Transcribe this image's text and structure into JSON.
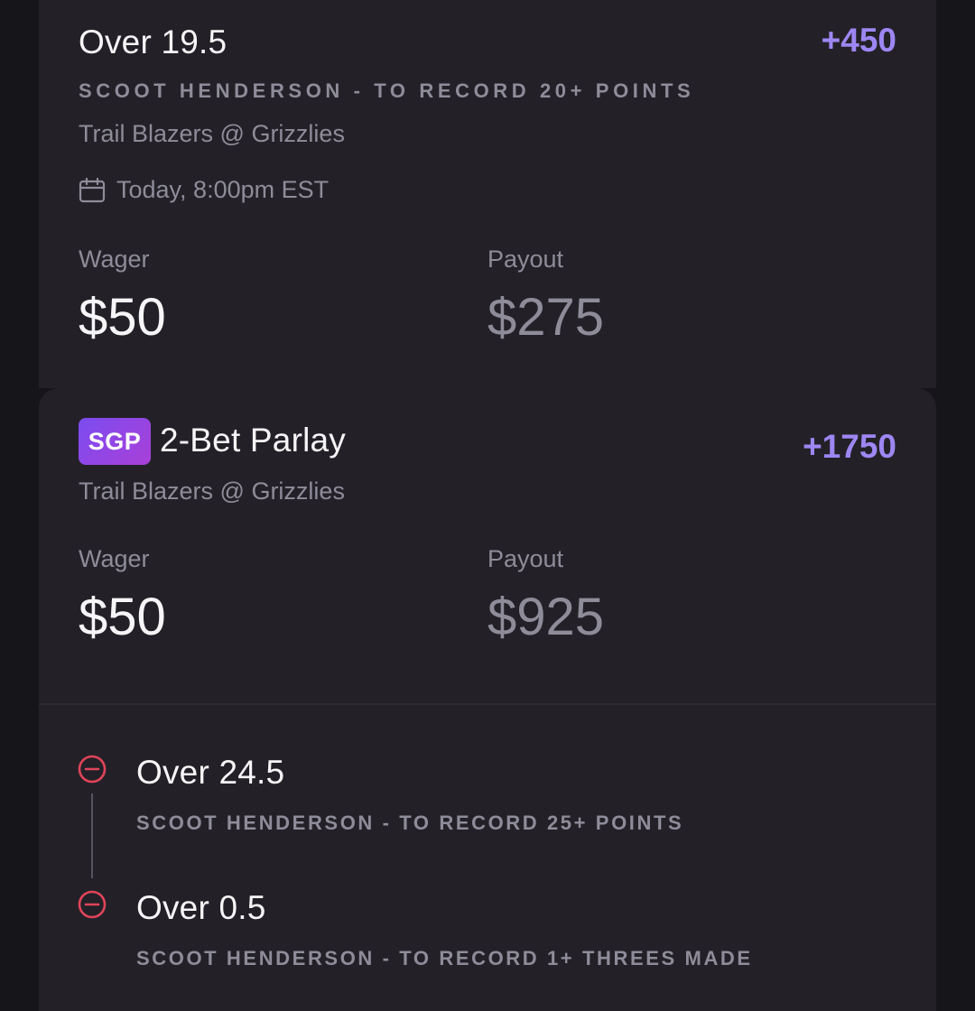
{
  "bet1": {
    "selection": "Over 19.5",
    "odds": "+450",
    "market": "SCOOT HENDERSON - TO RECORD 20+ POINTS",
    "game": "Trail Blazers @ Grizzlies",
    "time": "Today, 8:00pm EST",
    "wager_label": "Wager",
    "wager": "$50",
    "payout_label": "Payout",
    "payout": "$275"
  },
  "parlay": {
    "badge": "SGP",
    "title": "2-Bet Parlay",
    "odds": "+1750",
    "game": "Trail Blazers @ Grizzlies",
    "wager_label": "Wager",
    "wager": "$50",
    "payout_label": "Payout",
    "payout": "$925",
    "legs": [
      {
        "status": "lost",
        "selection": "Over 24.5",
        "market": "SCOOT HENDERSON - TO RECORD 25+ POINTS"
      },
      {
        "status": "lost",
        "selection": "Over 0.5",
        "market": "SCOOT HENDERSON - TO RECORD 1+ THREES MADE"
      }
    ]
  },
  "colors": {
    "background": "#161519",
    "card": "#232127",
    "accent_odds": "#9e86f3",
    "muted_text": "#8f8c9a",
    "loss_red": "#e0445a",
    "sgp_badge_start": "#7b4cf0",
    "sgp_badge_end": "#a940d8"
  },
  "icons": {
    "calendar": "calendar-icon",
    "leg_status": "minus-circle-icon"
  }
}
